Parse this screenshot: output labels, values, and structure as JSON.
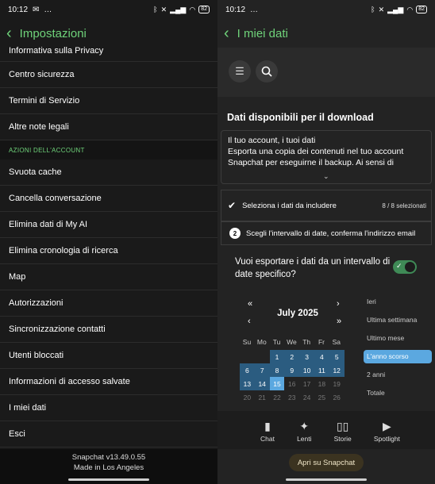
{
  "status": {
    "time": "10:12",
    "extra": "…",
    "battery": "82"
  },
  "left": {
    "title": "Impostazioni",
    "rows_top": [
      "Informativa sulla Privacy",
      "Centro sicurezza",
      "Termini di Servizio",
      "Altre note legali"
    ],
    "section": "AZIONI DELL'ACCOUNT",
    "rows": [
      "Svuota cache",
      "Cancella conversazione",
      "Elimina dati di My AI",
      "Elimina cronologia di ricerca",
      "Map",
      "Autorizzazioni",
      "Sincronizzazione contatti",
      "Utenti bloccati",
      "Informazioni di accesso salvate",
      "I miei dati",
      "Esci"
    ],
    "footer_line1": "Snapchat v13.49.0.55",
    "footer_line2": "Made in Los Angeles"
  },
  "right": {
    "title": "I miei dati",
    "download_title": "Dati disponibili per il download",
    "description": "Il tuo account, i tuoi dati\nEsporta una copia dei contenuti nel tuo account Snapchat per eseguirne il backup. Ai sensi di",
    "step1_label": "Seleziona i dati da includere",
    "step1_count": "8 / 8 selezionati",
    "step2_number": "2",
    "step2_label": "Scegli l'intervallo di date, conferma l'indirizzo email",
    "export_question": "Vuoi esportare i dati da un intervallo di date specifico?",
    "toggle_on": true,
    "calendar": {
      "month": "July 2025",
      "weekdays": [
        "Su",
        "Mo",
        "Tu",
        "We",
        "Th",
        "Fr",
        "Sa"
      ],
      "weeks": [
        [
          "",
          "",
          "1",
          "2",
          "3",
          "4",
          "5"
        ],
        [
          "6",
          "7",
          "8",
          "9",
          "10",
          "11",
          "12"
        ],
        [
          "13",
          "14",
          "15",
          "16",
          "17",
          "18",
          "19"
        ],
        [
          "20",
          "21",
          "22",
          "23",
          "24",
          "25",
          "26"
        ]
      ],
      "selected_through": 14,
      "today": 15
    },
    "presets": [
      "Ieri",
      "Ultima settimana",
      "Ultimo mese",
      "L'anno scorso",
      "2 anni",
      "Totale"
    ],
    "active_preset": "L'anno scorso",
    "tabs": [
      "Chat",
      "Lenti",
      "Storie",
      "Spotlight"
    ],
    "open_button": "Apri su Snapchat"
  }
}
